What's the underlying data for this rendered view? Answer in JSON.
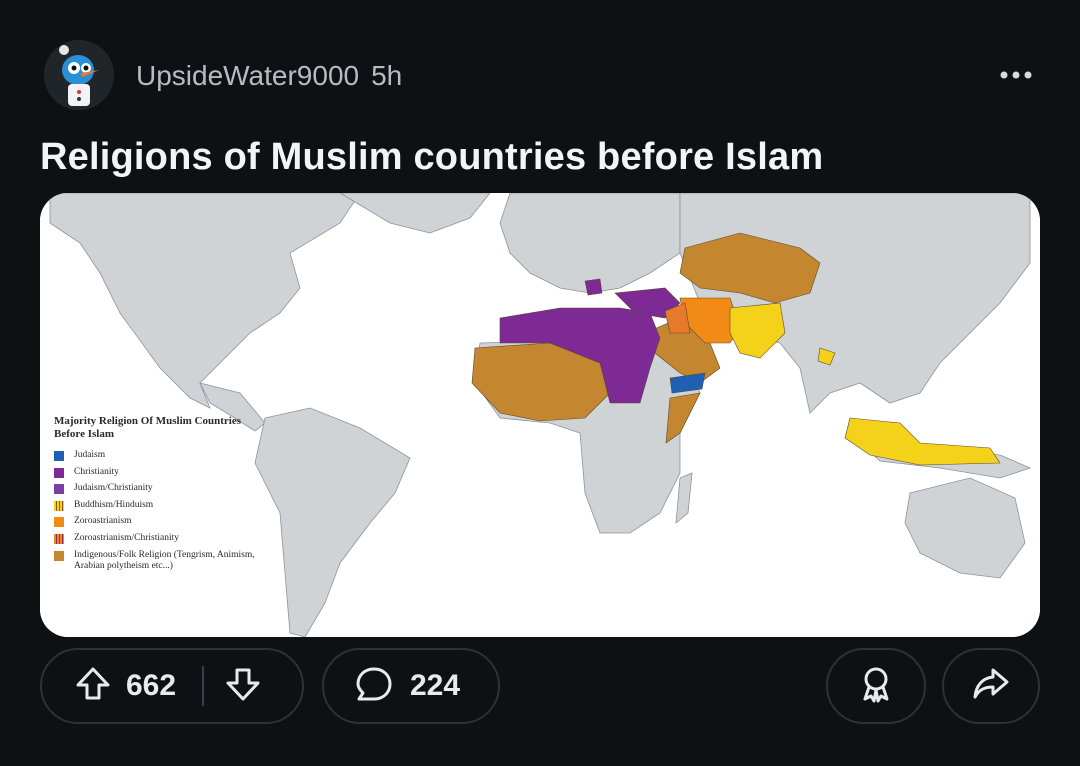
{
  "post": {
    "username": "UpsideWater9000",
    "age": "5h",
    "title": "Religions of Muslim countries before Islam"
  },
  "map": {
    "legend_title_line1": "Majority Religion Of Muslim Countries",
    "legend_title_line2": "Before Islam",
    "legend": [
      {
        "label": "Judaism",
        "color": "#1f5fb4"
      },
      {
        "label": "Christianity",
        "color": "#7d2a95"
      },
      {
        "label": "Judaism/Christianity",
        "color": "#7a3fa0"
      },
      {
        "label": "Buddhism/Hinduism",
        "color": "#f5d21a"
      },
      {
        "label": "Zoroastrianism",
        "color": "#f28a16"
      },
      {
        "label": "Zoroastrianism/Christianity",
        "color": "#f28a16"
      },
      {
        "label": "Indigenous/Folk Religion (Tengrism, Animism, Arabian polytheism etc...)",
        "color": "#c4872f"
      }
    ]
  },
  "actions": {
    "upvotes": "662",
    "comments": "224"
  },
  "colors": {
    "background": "#0e1113",
    "land": "#cfd3d6",
    "ocean": "#ffffff"
  }
}
